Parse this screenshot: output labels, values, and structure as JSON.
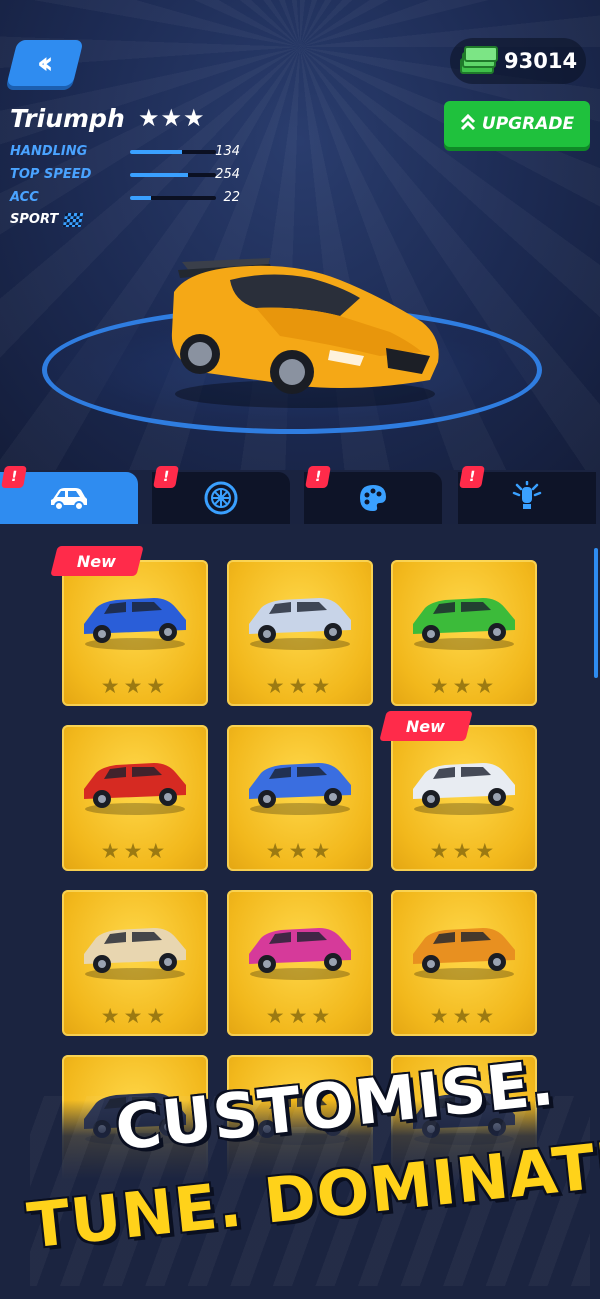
{
  "header": {
    "back_icon": "double-chevron-left-icon",
    "currency_icon": "cash-stack-icon",
    "currency_amount": "93014",
    "upgrade_label": "UPGRADE",
    "upgrade_icon": "double-chevron-up-icon"
  },
  "car": {
    "name": "Triumph",
    "stars": "★★★",
    "color": "#f5a816",
    "stats": [
      {
        "label": "HANDLING",
        "value": "134",
        "fill": 0.6
      },
      {
        "label": "TOP SPEED",
        "value": "254",
        "fill": 0.68
      },
      {
        "label": "ACC",
        "value": "22",
        "fill": 0.24
      }
    ],
    "class_label": "SPORT",
    "class_icon": "checkered-flag-icon"
  },
  "tabs": [
    {
      "icon": "car-icon",
      "alert": "!",
      "active": true
    },
    {
      "icon": "wheel-icon",
      "alert": "!",
      "active": false
    },
    {
      "icon": "paint-palette-icon",
      "alert": "!",
      "active": false
    },
    {
      "icon": "light-bulb-icon",
      "alert": "!",
      "active": false
    }
  ],
  "grid": {
    "cards": [
      {
        "car": "blue-funny-car",
        "color": "#2a5ed8",
        "stars": "★★★",
        "new": "New"
      },
      {
        "car": "silver-dragster-concept",
        "color": "#c8d4e8",
        "stars": "★★★",
        "new": ""
      },
      {
        "car": "green-convertible",
        "color": "#3cbb3a",
        "stars": "★★★",
        "new": ""
      },
      {
        "car": "red-hot-rod",
        "color": "#d62a22",
        "stars": "★★★",
        "new": ""
      },
      {
        "car": "stars-and-stripes-dragster",
        "color": "#3a6ee0",
        "stars": "★★★",
        "new": ""
      },
      {
        "car": "muscle-car-stars",
        "color": "#e8ecf2",
        "stars": "★★★",
        "new": "New"
      },
      {
        "car": "cream-offroad-suv",
        "color": "#e8d6b0",
        "stars": "★★★",
        "new": ""
      },
      {
        "car": "pink-hypercar",
        "color": "#d63a9a",
        "stars": "★★★",
        "new": ""
      },
      {
        "car": "orange-dune-buggy",
        "color": "#e89020",
        "stars": "★★★",
        "new": ""
      },
      {
        "car": "dark-truck",
        "color": "#2a3350",
        "stars": "",
        "new": ""
      },
      {
        "car": "hidden-car",
        "color": "#f2b81c",
        "stars": "",
        "new": ""
      },
      {
        "car": "hidden-car-2",
        "color": "#2a3350",
        "stars": "",
        "new": ""
      }
    ]
  },
  "promo": {
    "line1": "CUSTOMISE.",
    "line2": "TUNE. DOMINATE.",
    "line1_color": "#ffffff",
    "line2_color": "#ffd21a"
  }
}
